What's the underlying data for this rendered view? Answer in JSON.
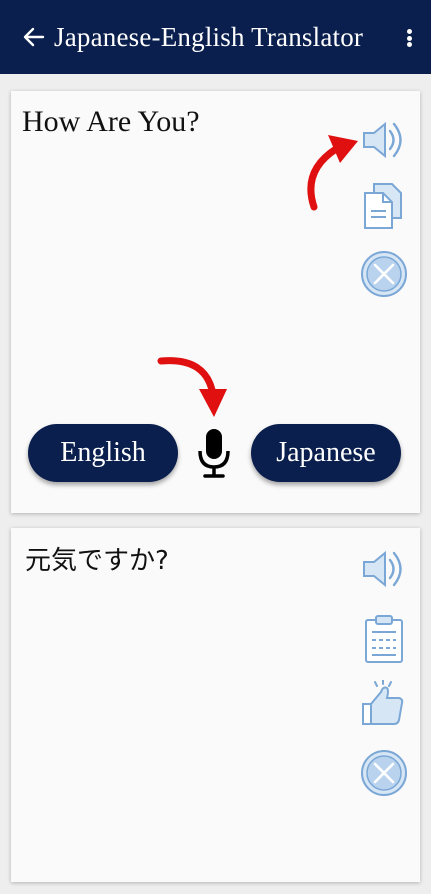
{
  "app_bar": {
    "title": "Japanese-English Translator",
    "back_icon": "arrow-left-icon",
    "menu_icon": "more-vertical-icon",
    "background": "#0a1f4d"
  },
  "source_card": {
    "text": "How Are You?",
    "icons": [
      "speaker-icon",
      "copy-icon",
      "clear-icon"
    ],
    "source_language_button": "English",
    "target_language_button": "Japanese",
    "mic_icon": "microphone-icon"
  },
  "target_card": {
    "text": "元気ですか?",
    "icons": [
      "speaker-icon",
      "clipboard-icon",
      "thumbs-up-icon",
      "clear-icon"
    ]
  },
  "colors": {
    "accent": "#0a1f4d",
    "icon_blue": "#7aa7d6",
    "annotation_red": "#e01010"
  }
}
